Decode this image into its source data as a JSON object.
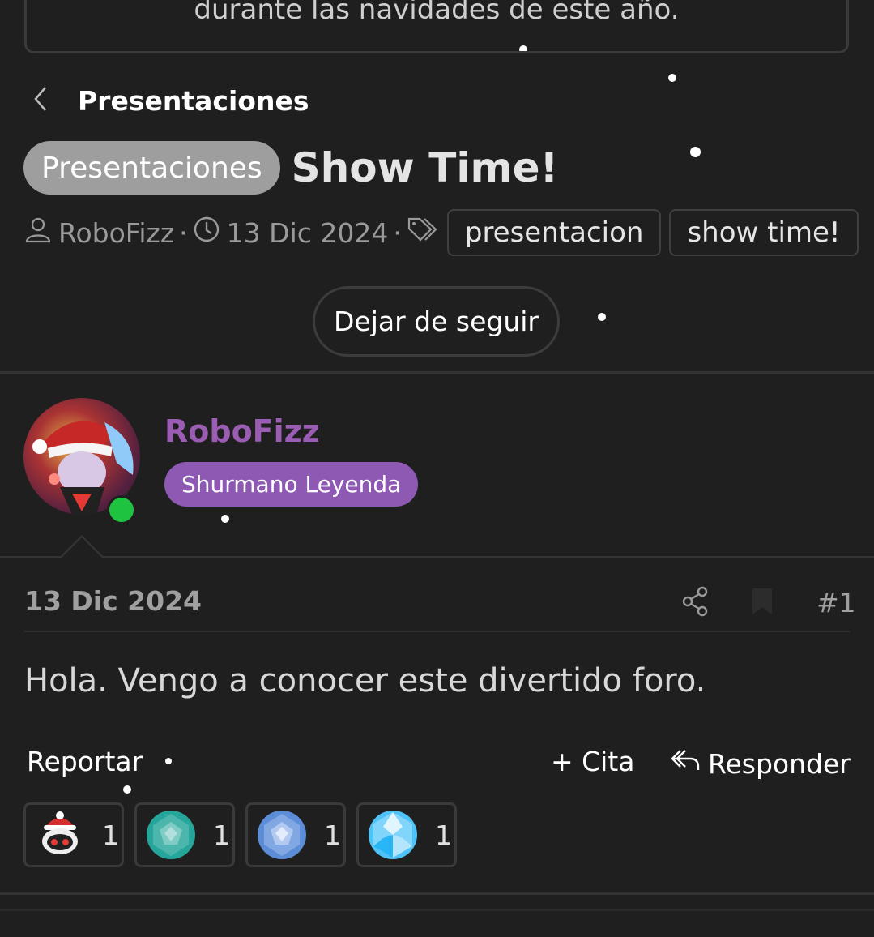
{
  "top_notice": {
    "text": "durante las navidades de este año."
  },
  "breadcrumb": {
    "title": "Presentaciones"
  },
  "thread": {
    "prefix": "Presentaciones",
    "title": "Show Time!",
    "author": "RoboFizz",
    "date": "13 Dic 2024",
    "separator": "·",
    "tags": [
      "presentacion",
      "show time!"
    ]
  },
  "follow_button": {
    "label": "Dejar de seguir"
  },
  "user": {
    "name": "RoboFizz",
    "title": "Shurmano Leyenda",
    "online": true
  },
  "post": {
    "date": "13 Dic 2024",
    "number": "#1",
    "body": "Hola. Vengo a conocer este divertido foro.",
    "actions": {
      "report": "Reportar",
      "quote": "+ Cita",
      "reply": "Responder"
    },
    "reactions": [
      {
        "icon": "santa-robot-icon",
        "count": "1"
      },
      {
        "icon": "teal-gem-icon",
        "count": "1"
      },
      {
        "icon": "blue-gem-icon",
        "count": "1"
      },
      {
        "icon": "diamond-icon",
        "count": "1"
      }
    ]
  },
  "colors": {
    "background": "#1f1f1f",
    "username": "#9b5db3",
    "user_title_bg": "#8e59b3",
    "prefix_bg": "#9e9e9e",
    "online": "#1ec43f"
  }
}
